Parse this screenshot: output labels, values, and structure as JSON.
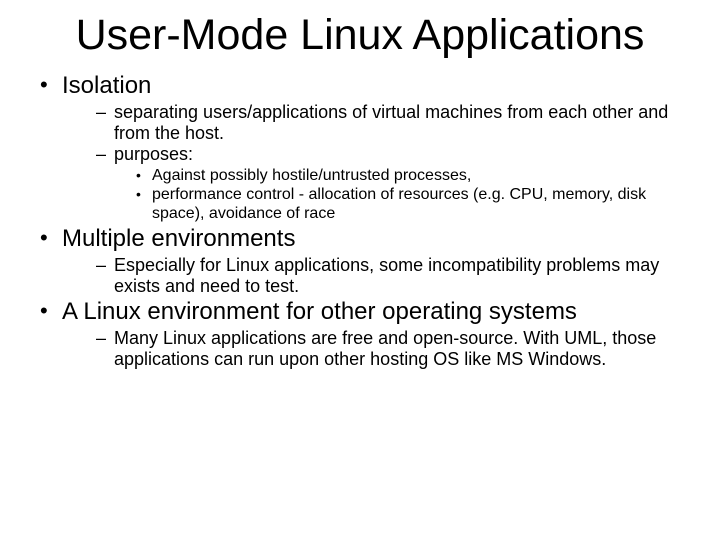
{
  "title": "User-Mode Linux Applications",
  "bullets": [
    {
      "text": "Isolation",
      "sub": [
        {
          "text": "separating users/applications of virtual machines from each other and from the host."
        },
        {
          "text": "purposes:",
          "sub": [
            {
              "text": "Against possibly hostile/untrusted processes,"
            },
            {
              "text": "performance control - allocation of resources (e.g. CPU, memory, disk space), avoidance of race"
            }
          ]
        }
      ]
    },
    {
      "text": "Multiple environments",
      "sub": [
        {
          "text": "Especially for Linux applications, some incompatibility problems may exists and need to test."
        }
      ]
    },
    {
      "text": "A Linux environment for other operating systems",
      "sub": [
        {
          "text": "Many Linux applications are free and open-source. With UML, those applications can run upon other hosting OS like MS Windows."
        }
      ]
    }
  ]
}
